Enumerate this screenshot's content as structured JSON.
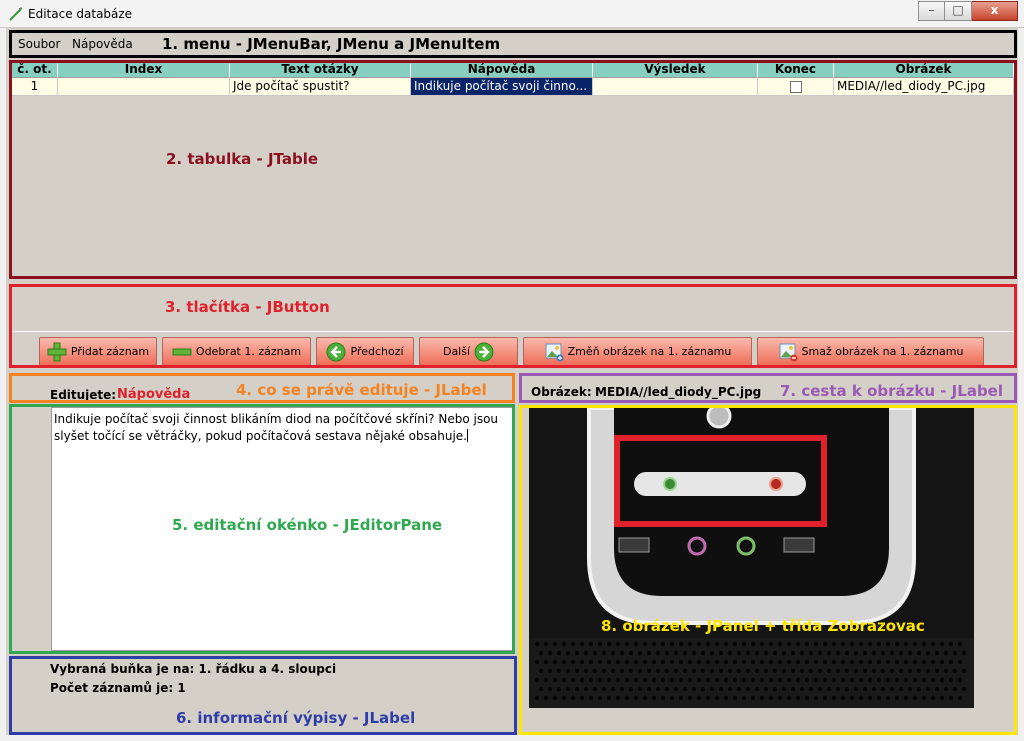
{
  "window": {
    "title": "Editace databáze",
    "minimize_glyph": "–",
    "maximize_glyph": "□",
    "close_glyph": "x"
  },
  "menu": {
    "items": [
      {
        "label": "Soubor"
      },
      {
        "label": "Nápověda"
      }
    ]
  },
  "table": {
    "columns": [
      "č. ot.",
      "Index",
      "Text otázky",
      "Nápověda",
      "Výsledek",
      "Konec",
      "Obrázek"
    ],
    "rows": [
      {
        "id": "1",
        "index": "",
        "question": "Jde počítač spustit?",
        "hint": "Indikuje počítač svoji činno...",
        "result": "",
        "end": false,
        "image": "MEDIA//led_diody_PC.jpg"
      }
    ]
  },
  "buttons": {
    "add": "Přidat záznam",
    "remove": "Odebrat 1. záznam",
    "prev": "Předchozí",
    "next": "Další",
    "change_image": "Změň obrázek na 1. záznamu",
    "delete_image": "Smaž obrázek na 1. záznamu"
  },
  "editing": {
    "label": "Editujete:",
    "value": "Nápověda"
  },
  "image_path": {
    "label": "Obrázek:",
    "value": "MEDIA//led_diody_PC.jpg"
  },
  "editor": {
    "text": "Indikuje počítač svoji činnost blikáním diod na počítčové skříni? Nebo jsou slyšet točící se větráčky, pokud počítačová sestava nějaké obsahuje."
  },
  "info": {
    "selected_cell": "Vybraná buňka je na: 1. řádku a 4. sloupci",
    "record_count": "Počet záznamů je: 1"
  },
  "annotations": {
    "menu": "1. menu - JMenuBar, JMenu a JMenuItem",
    "table": "2. tabulka - JTable",
    "buttons": "3. tlačítka - JButton",
    "editing": "4. co se právě edituje - JLabel",
    "editor": "5. editační okénko - JEditorPane",
    "info": "6. informační výpisy - JLabel",
    "image_path": "7. cesta k obrázku - JLabel",
    "image": "8. obrázek - JPanel + třída Zobrazovac"
  },
  "colors": {
    "menu_annotation": "#000000",
    "table_annotation": "#8b0f1e",
    "buttons_annotation": "#e0202b",
    "editing_annotation": "#f58220",
    "editor_annotation": "#2fa84f",
    "info_annotation": "#2f3da8",
    "image_path_annotation": "#9b59b6",
    "image_annotation": "#ffe600",
    "table_header": "#86cfc1",
    "selected_cell": "#0a246a"
  }
}
